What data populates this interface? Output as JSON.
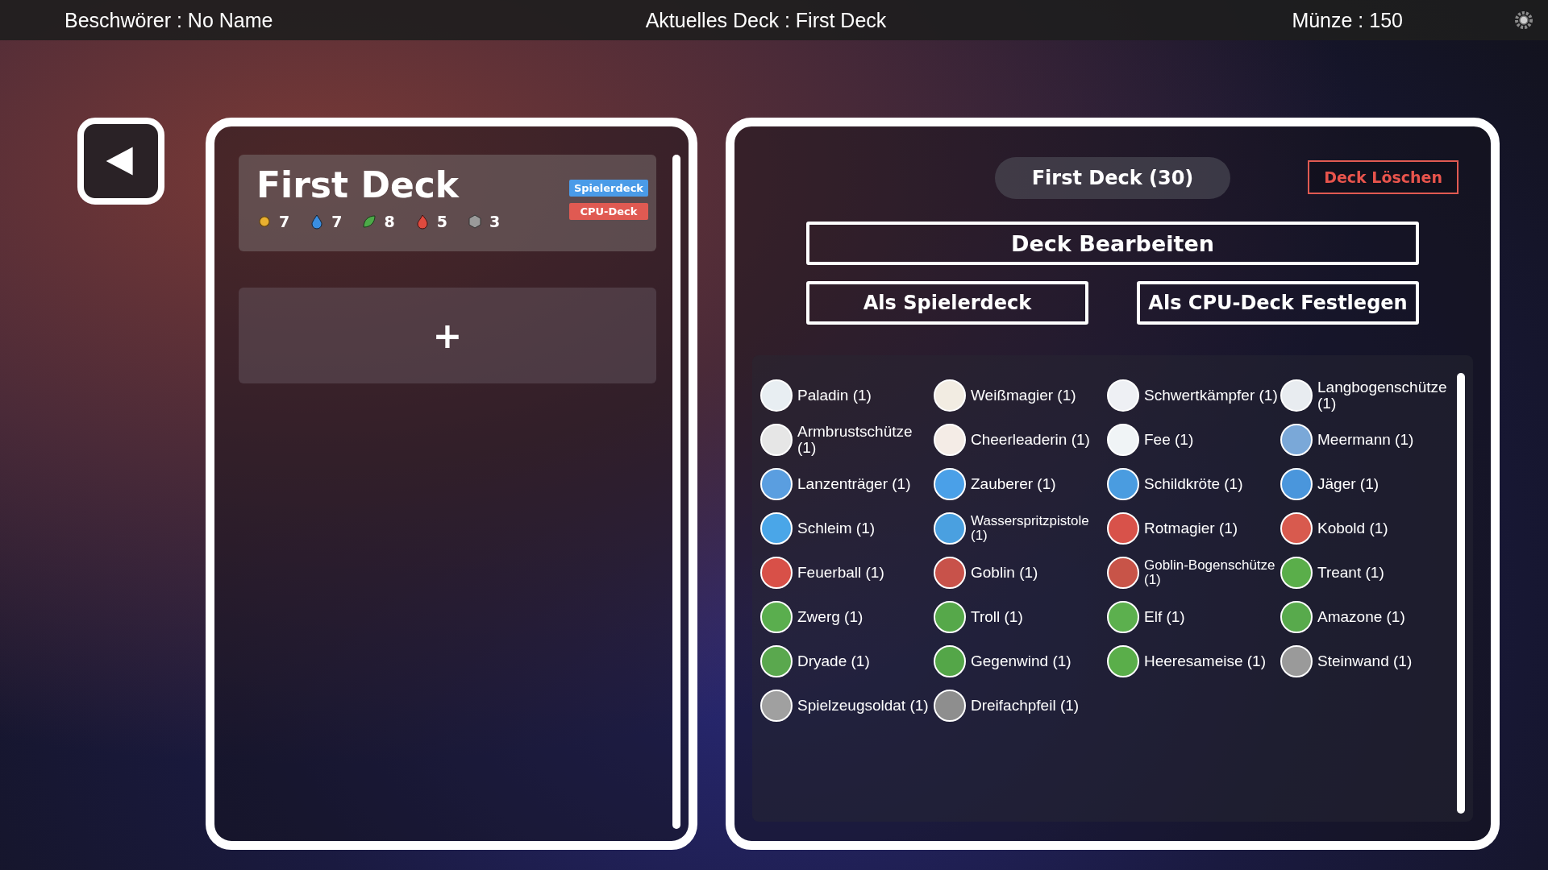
{
  "top_bar": {
    "summoner": "Beschwörer : No Name",
    "current_deck": "Aktuelles Deck : First Deck",
    "coins": "Münze : 150"
  },
  "deck_card": {
    "title": "First Deck",
    "badges": [
      {
        "label": "Spielerdeck",
        "color": "#4a9be8"
      },
      {
        "label": "CPU-Deck",
        "color": "#e05a52"
      }
    ],
    "stats": [
      {
        "kind": "light",
        "value": "7"
      },
      {
        "kind": "water",
        "value": "7"
      },
      {
        "kind": "leaf",
        "value": "8"
      },
      {
        "kind": "fire",
        "value": "5"
      },
      {
        "kind": "neutral",
        "value": "3"
      }
    ]
  },
  "add_tile": {
    "label": "+"
  },
  "detail": {
    "title": "First Deck (30)",
    "delete_button": "Deck Löschen",
    "edit_button": "Deck Bearbeiten",
    "player_button": "Als Spielerdeck",
    "cpu_button": "Als CPU-Deck Festlegen",
    "cards": [
      {
        "label": "Paladin (1)",
        "color": "#e8eef2"
      },
      {
        "label": "Weißmagier (1)",
        "color": "#f2ece2"
      },
      {
        "label": "Schwertkämpfer (1)",
        "color": "#eef0f4"
      },
      {
        "label": "Langbogenschütze (1)",
        "color": "#e8ecf0"
      },
      {
        "label": "Armbrustschütze (1)",
        "color": "#e6e6e6"
      },
      {
        "label": "Cheerleaderin (1)",
        "color": "#f4ece6"
      },
      {
        "label": "Fee (1)",
        "color": "#f0f4f6"
      },
      {
        "label": "Meermann (1)",
        "color": "#7aa8d8"
      },
      {
        "label": "Lanzenträger (1)",
        "color": "#5a9ee0"
      },
      {
        "label": "Zauberer (1)",
        "color": "#4aa0e8"
      },
      {
        "label": "Schildkröte (1)",
        "color": "#4a9ce0"
      },
      {
        "label": "Jäger (1)",
        "color": "#4a96dc"
      },
      {
        "label": "Schleim (1)",
        "color": "#4aa6e8"
      },
      {
        "label": "Wasserspritzpistole (1)",
        "color": "#4aa0e0"
      },
      {
        "label": "Rotmagier (1)",
        "color": "#d8524a"
      },
      {
        "label": "Kobold (1)",
        "color": "#d85a4e"
      },
      {
        "label": "Feuerball (1)",
        "color": "#d85048"
      },
      {
        "label": "Goblin (1)",
        "color": "#c8524a"
      },
      {
        "label": "Goblin-Bogenschütze (1)",
        "color": "#c85448"
      },
      {
        "label": "Treant (1)",
        "color": "#5aae4a"
      },
      {
        "label": "Zwerg (1)",
        "color": "#5aae4e"
      },
      {
        "label": "Troll (1)",
        "color": "#56a84a"
      },
      {
        "label": "Elf (1)",
        "color": "#5cb04e"
      },
      {
        "label": "Amazone (1)",
        "color": "#58aa4c"
      },
      {
        "label": "Dryade (1)",
        "color": "#5aa84e"
      },
      {
        "label": "Gegenwind (1)",
        "color": "#54a648"
      },
      {
        "label": "Heeresameise (1)",
        "color": "#5aae4a"
      },
      {
        "label": "Steinwand (1)",
        "color": "#9a9a9a"
      },
      {
        "label": "Spielzeugsoldat (1)",
        "color": "#a0a0a0"
      },
      {
        "label": "Dreifachpfeil (1)",
        "color": "#8e8e8e"
      }
    ]
  }
}
